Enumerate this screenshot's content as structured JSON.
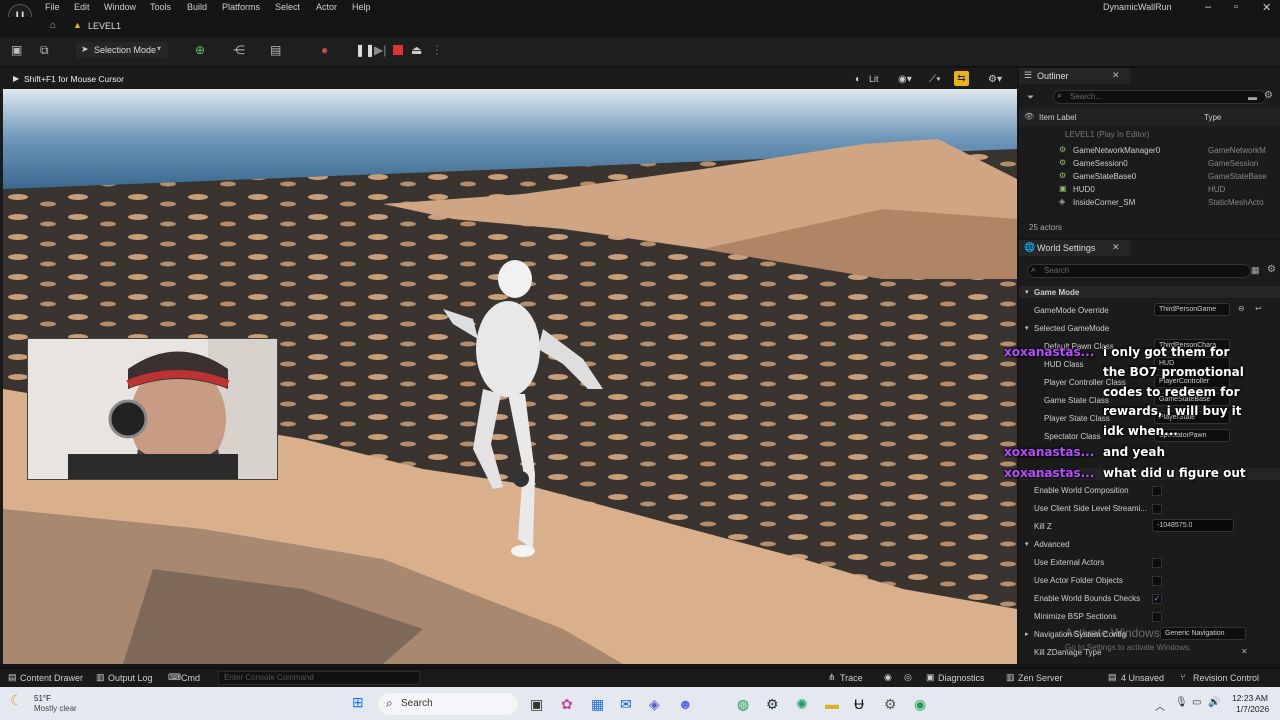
{
  "window": {
    "title": "DynamicWallRun",
    "level_tab": "LEVEL1"
  },
  "menu": [
    "File",
    "Edit",
    "Window",
    "Tools",
    "Build",
    "Platforms",
    "Select",
    "Actor",
    "Help"
  ],
  "toolbar": {
    "mode": "Selection Mode"
  },
  "viewport": {
    "hint": "Shift+F1 for Mouse Cursor",
    "view_mode": "Lit"
  },
  "outliner": {
    "tab": "Outliner",
    "search_placeholder": "Search...",
    "col_label": "Item Label",
    "col_type": "Type",
    "root": "LEVEL1 (Play In Editor)",
    "rows": [
      {
        "label": "GameNetworkManager0",
        "type": "GameNetworkM"
      },
      {
        "label": "GameSession0",
        "type": "GameSession"
      },
      {
        "label": "GameStateBase0",
        "type": "GameStateBase"
      },
      {
        "label": "HUD0",
        "type": "HUD"
      },
      {
        "label": "InsideCorner_SM",
        "type": "StaticMeshActo"
      }
    ],
    "count": "25 actors"
  },
  "world_settings": {
    "tab": "World Settings",
    "search_placeholder": "Search",
    "section_game_mode": "Game Mode",
    "gamemode_override_label": "GameMode Override",
    "gamemode_override_value": "ThirdPersonGame",
    "selected_gamemode": "Selected GameMode",
    "props": [
      {
        "label": "Default Pawn Class",
        "value": "ThirdPersonChara"
      },
      {
        "label": "HUD Class",
        "value": "HUD"
      },
      {
        "label": "Player Controller Class",
        "value": "PlayerController"
      },
      {
        "label": "Game State Class",
        "value": "GameStateBase"
      },
      {
        "label": "Player State Class",
        "value": "PlayerState"
      },
      {
        "label": "Spectator Class",
        "value": "SpectatorPawn"
      }
    ],
    "section_world": "World",
    "world_rows": [
      {
        "label": "Enable World Composition"
      },
      {
        "label": "Use Client Side Level Streami..."
      }
    ],
    "kill_z_label": "Kill Z",
    "kill_z_value": "-1048575.0",
    "section_advanced": "Advanced",
    "advanced_rows": [
      {
        "label": "Use External Actors",
        "checked": false
      },
      {
        "label": "Use Actor Folder Objects",
        "checked": false
      },
      {
        "label": "Enable World Bounds Checks",
        "checked": true
      },
      {
        "label": "Minimize BSP Sections",
        "checked": false
      }
    ],
    "nav_label": "Navigation System Config",
    "nav_value": "Generic Navigation",
    "kill_zdamage_label": "Kill ZDamage Type",
    "activate_1": "Activate Windows",
    "activate_2": "Go to Settings to activate Windows."
  },
  "chat": [
    {
      "name": "xoxanastas...",
      "lines": [
        "i only got them for",
        "the BO7 promotional",
        "codes to redeem for",
        "rewards, i will buy it",
        "idk when..."
      ]
    },
    {
      "name": "xoxanastas...",
      "lines": [
        "and yeah"
      ]
    },
    {
      "name": "xoxanastas...",
      "lines": [
        "what did u figure out"
      ]
    }
  ],
  "statusbar": {
    "content_drawer": "Content Drawer",
    "output_log": "Output Log",
    "cmd": "Cmd",
    "console_placeholder": "Enter Console Command",
    "trace": "Trace",
    "diagnostics": "Diagnostics",
    "zen": "Zen Server",
    "unsaved": "4 Unsaved",
    "revision": "Revision Control"
  },
  "taskbar": {
    "weather_temp": "51°F",
    "weather_desc": "Mostly clear",
    "search": "Search",
    "time": "12:23 AM",
    "date": "1/7/2026"
  },
  "colors": {
    "accent_yellow": "#e8b21b",
    "chat_name": "#b44cff",
    "stop_red": "#d33"
  }
}
